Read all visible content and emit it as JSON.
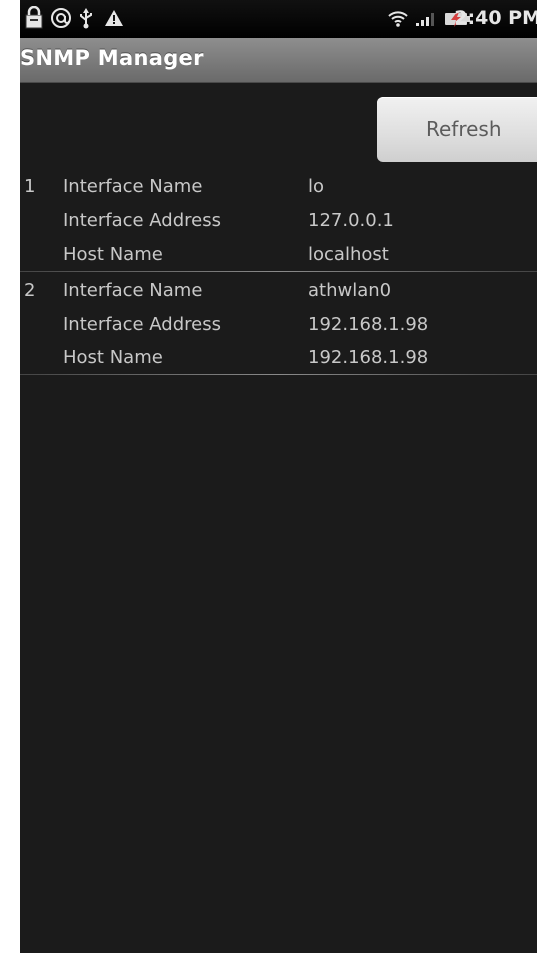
{
  "status_bar": {
    "icons": [
      "lock-icon",
      "at-icon",
      "usb-icon",
      "warning-icon",
      "wifi-icon",
      "signal-icon",
      "battery-charging-icon"
    ],
    "time": "2:40 PM"
  },
  "app": {
    "title": "SNMP Manager"
  },
  "actions": {
    "refresh_label": "Refresh"
  },
  "interfaces": [
    {
      "index": "1",
      "name_label": "Interface Name",
      "name": "lo",
      "address_label": "Interface Address",
      "address": "127.0.0.1",
      "host_label": "Host Name",
      "host": "localhost"
    },
    {
      "index": "2",
      "name_label": "Interface Name",
      "name": "athwlan0",
      "address_label": "Interface Address",
      "address": "192.168.1.98",
      "host_label": "Host Name",
      "host": "192.168.1.98"
    }
  ]
}
